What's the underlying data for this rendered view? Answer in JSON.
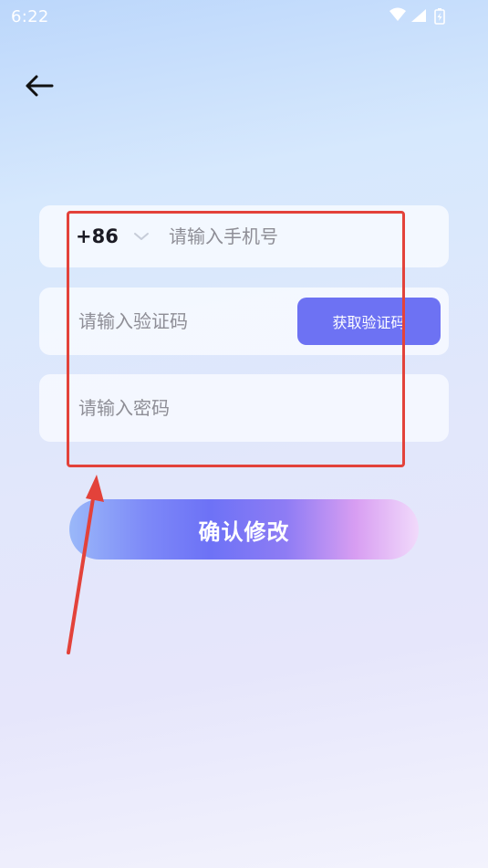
{
  "status_bar": {
    "time": "6:22",
    "icons": [
      "wifi-icon",
      "signal-icon",
      "battery-charging-icon"
    ]
  },
  "nav": {
    "back_icon": "arrow-left-icon"
  },
  "form": {
    "phone": {
      "country_code": "+86",
      "placeholder": "请输入手机号",
      "value": ""
    },
    "verification_code": {
      "placeholder": "请输入验证码",
      "value": "",
      "button_label": "获取验证码"
    },
    "password": {
      "placeholder": "请输入密码",
      "value": ""
    },
    "submit_label": "确认修改"
  },
  "colors": {
    "accent": "#6d72f3",
    "annotation": "#e3423a",
    "field_background": "#f5f9ff"
  }
}
